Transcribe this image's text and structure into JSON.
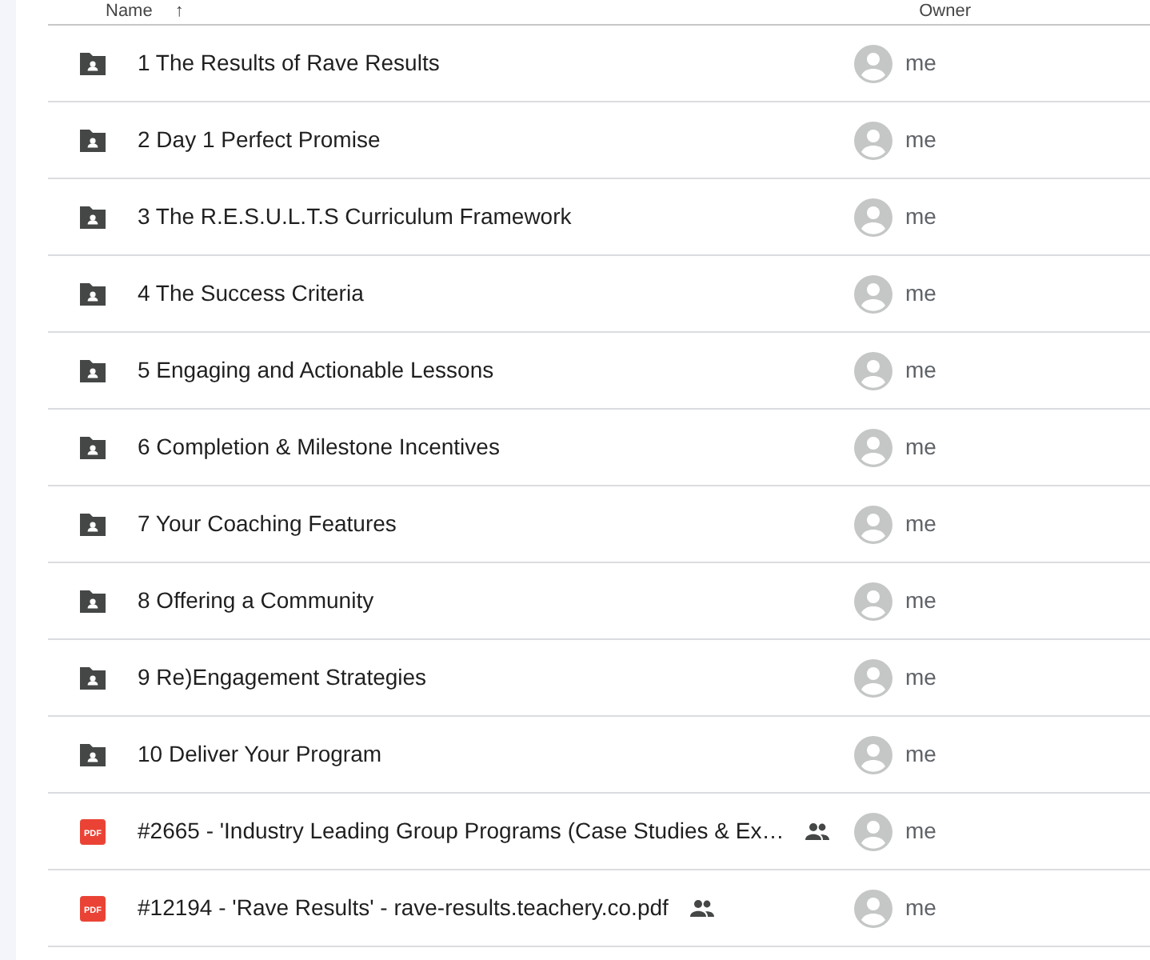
{
  "columns": [
    {
      "label": "Name"
    },
    {
      "label": "↑"
    },
    {
      "label": "Owner"
    }
  ],
  "rows": [
    {
      "kind": "folder",
      "name": "1 The Results of Rave Results",
      "shared": false,
      "owner": "me"
    },
    {
      "kind": "folder",
      "name": "2 Day 1 Perfect Promise",
      "shared": false,
      "owner": "me"
    },
    {
      "kind": "folder",
      "name": "3 The R.E.S.U.L.T.S Curriculum Framework",
      "shared": false,
      "owner": "me"
    },
    {
      "kind": "folder",
      "name": "4 The Success Criteria",
      "shared": false,
      "owner": "me"
    },
    {
      "kind": "folder",
      "name": "5 Engaging and Actionable Lessons",
      "shared": false,
      "owner": "me"
    },
    {
      "kind": "folder",
      "name": "6 Completion & Milestone Incentives",
      "shared": false,
      "owner": "me"
    },
    {
      "kind": "folder",
      "name": "7 Your Coaching Features",
      "shared": false,
      "owner": "me"
    },
    {
      "kind": "folder",
      "name": "8 Offering a Community",
      "shared": false,
      "owner": "me"
    },
    {
      "kind": "folder",
      "name": "9 Re)Engagement Strategies",
      "shared": false,
      "owner": "me"
    },
    {
      "kind": "folder",
      "name": "10 Deliver Your Program",
      "shared": false,
      "owner": "me"
    },
    {
      "kind": "pdf",
      "badge": "PDF",
      "name": "#2665 - 'Industry Leading Group Programs (Case Studies & Ex…",
      "shared": true,
      "owner": "me"
    },
    {
      "kind": "pdf",
      "badge": "PDF",
      "name": "#12194 - 'Rave Results' - rave-results.teachery.co.pdf",
      "shared": true,
      "owner": "me"
    }
  ]
}
